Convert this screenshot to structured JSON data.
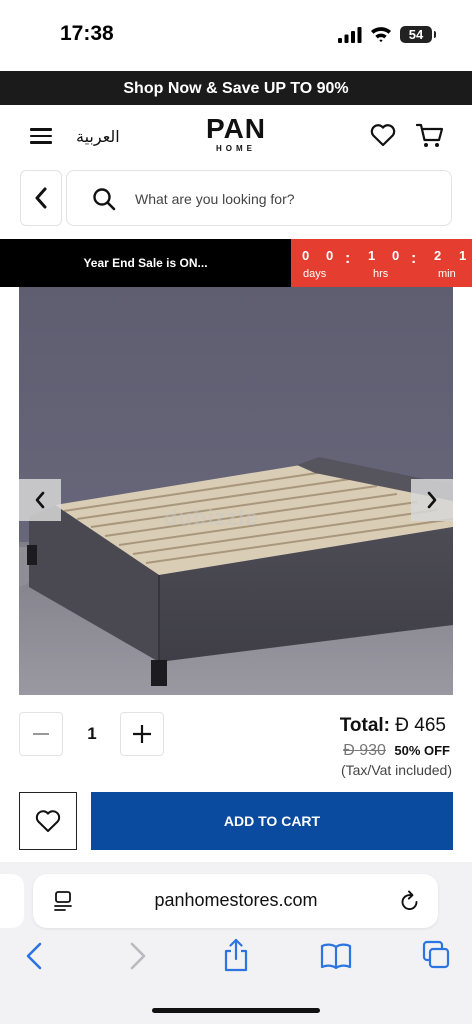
{
  "status_bar": {
    "time": "17:38",
    "battery": "54"
  },
  "promo_banner": {
    "text": "Shop Now & Save UP TO 90%"
  },
  "header": {
    "language_link": "العربية",
    "logo_main": "PAN",
    "logo_sub": "HOME",
    "icons": [
      "menu-icon",
      "heart-icon",
      "cart-icon"
    ]
  },
  "search": {
    "placeholder": "What are you looking for?"
  },
  "sale": {
    "label": "Year End Sale is ON...",
    "countdown": {
      "days_digits": [
        "0",
        "0"
      ],
      "hours_digits": [
        "1",
        "0"
      ],
      "minutes_digits": [
        "2",
        "1"
      ],
      "days_label": "days",
      "hours_label": "hrs",
      "minutes_label": "min"
    }
  },
  "product": {
    "image_alt": "Grey upholstered bed frame with wooden slats",
    "watermark": "dubizzle",
    "quantity": "1",
    "total_label": "Total:",
    "currency_symbol": "Đ",
    "total_price": "465",
    "old_price": "930",
    "discount": "50% OFF",
    "tax_note": "(Tax/Vat included)",
    "add_to_cart_label": "ADD TO CART"
  },
  "browser": {
    "url": "panhomestores.com"
  }
}
